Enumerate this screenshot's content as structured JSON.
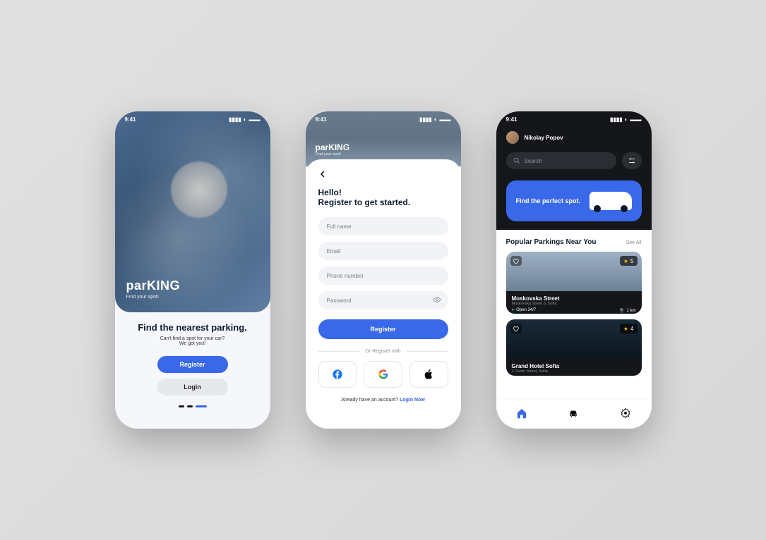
{
  "status": {
    "time": "9:41"
  },
  "brand": {
    "name": "parKING",
    "tagline": "Find your spot!"
  },
  "screen1": {
    "title": "Find the nearest parking.",
    "sub1": "Can't find a spot for your car?",
    "sub2": "We got you!",
    "register": "Register",
    "login": "Login"
  },
  "screen2": {
    "h1": "Hello!",
    "h2": "Register to get started.",
    "fields": {
      "fullname": "Full name",
      "email": "Email",
      "phone": "Phone number",
      "password": "Password"
    },
    "register_btn": "Register",
    "or_text": "Or Register with",
    "already_text": "Already have an account?",
    "login_link": "Login Now"
  },
  "screen3": {
    "user": "Nikolay Popov",
    "search_placeholder": "Search",
    "promo": "Find the perfect spot.",
    "section_title": "Popular Parkings Near You",
    "see_all": "See All",
    "card1": {
      "name": "Moskovska Street",
      "address": "Moskovska Street 5, Sofia",
      "open": "Open 24/7",
      "distance": "1 km",
      "rating": "5"
    },
    "card2": {
      "name": "Grand Hotel Sofia",
      "address": "1 Gurko Street, Sofia",
      "rating": "4"
    }
  }
}
